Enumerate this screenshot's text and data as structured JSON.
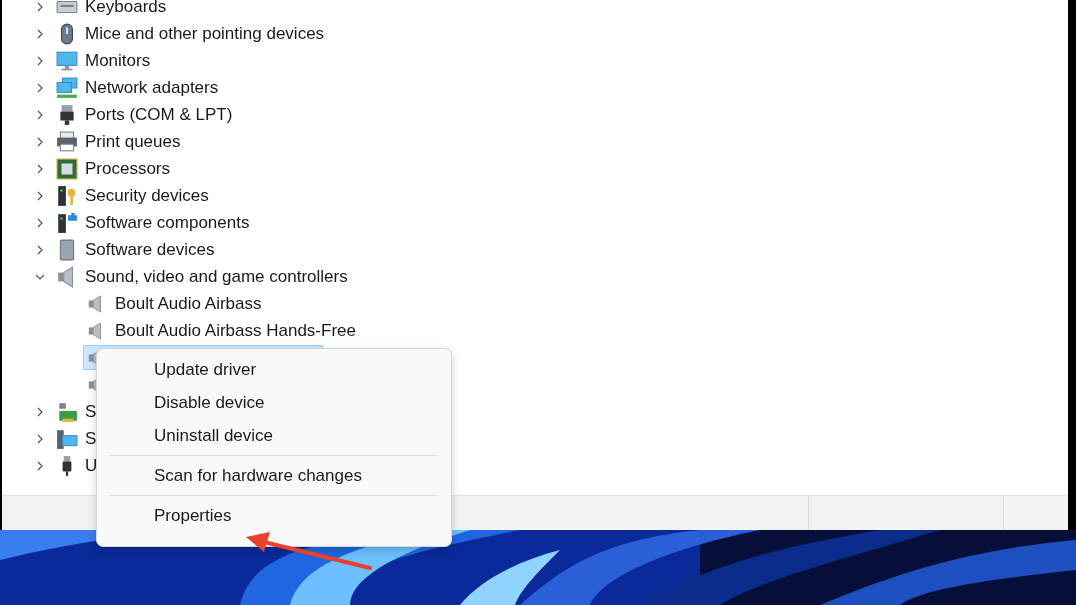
{
  "device_tree": [
    {
      "label": "Keyboards",
      "kind": "keyboard",
      "expanded": false,
      "selected": false
    },
    {
      "label": "Mice and other pointing devices",
      "kind": "mouse",
      "expanded": false,
      "selected": false
    },
    {
      "label": "Monitors",
      "kind": "monitor",
      "expanded": false,
      "selected": false
    },
    {
      "label": "Network adapters",
      "kind": "network",
      "expanded": false,
      "selected": false
    },
    {
      "label": "Ports (COM & LPT)",
      "kind": "port",
      "expanded": false,
      "selected": false
    },
    {
      "label": "Print queues",
      "kind": "printer",
      "expanded": false,
      "selected": false
    },
    {
      "label": "Processors",
      "kind": "chip",
      "expanded": false,
      "selected": false
    },
    {
      "label": "Security devices",
      "kind": "security",
      "expanded": false,
      "selected": false
    },
    {
      "label": "Software components",
      "kind": "component",
      "expanded": false,
      "selected": false
    },
    {
      "label": "Software devices",
      "kind": "tower",
      "expanded": false,
      "selected": false
    },
    {
      "label": "Sound, video and game controllers",
      "kind": "speaker",
      "expanded": true,
      "selected": false,
      "children": [
        {
          "label": "Boult Audio Airbass",
          "kind": "speaker",
          "selected": false
        },
        {
          "label": "Boult Audio Airbass Hands-Free",
          "kind": "speaker",
          "selected": false
        },
        {
          "kind": "speaker",
          "selected": true
        },
        {
          "kind": "speaker",
          "selected": false
        }
      ]
    },
    {
      "label": "S",
      "kind": "card",
      "expanded": false,
      "selected": false
    },
    {
      "label": "S",
      "kind": "system",
      "expanded": false,
      "selected": false
    },
    {
      "label": "U",
      "kind": "usb",
      "expanded": false,
      "selected": false
    }
  ],
  "context_menu": [
    {
      "kind": "item",
      "label": "Update driver"
    },
    {
      "kind": "item",
      "label": "Disable device"
    },
    {
      "kind": "item",
      "label": "Uninstall device"
    },
    {
      "kind": "separator"
    },
    {
      "kind": "item",
      "label": "Scan for hardware changes"
    },
    {
      "kind": "separator"
    },
    {
      "kind": "item",
      "label": "Properties"
    }
  ]
}
